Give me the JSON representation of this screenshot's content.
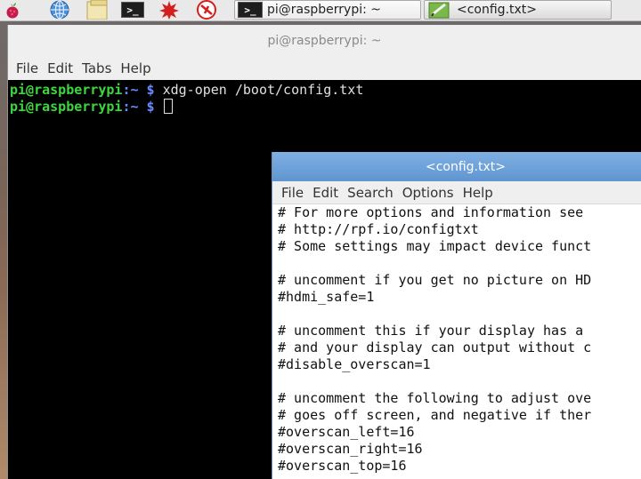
{
  "taskbar": {
    "terminal_task_label": "pi@raspberrypi: ~",
    "editor_task_label": "<config.txt>"
  },
  "terminal": {
    "title": "pi@raspberrypi: ~",
    "menu": [
      "File",
      "Edit",
      "Tabs",
      "Help"
    ],
    "lines": [
      {
        "user": "pi@raspberrypi",
        "path": ":~",
        "sign": " $",
        "command": " xdg-open /boot/config.txt",
        "cursor": false
      },
      {
        "user": "pi@raspberrypi",
        "path": ":~",
        "sign": " $",
        "command": " ",
        "cursor": true
      }
    ]
  },
  "editor": {
    "title": "<config.txt>",
    "menu": [
      "File",
      "Edit",
      "Search",
      "Options",
      "Help"
    ],
    "lines": [
      "# For more options and information see",
      "# http://rpf.io/configtxt",
      "# Some settings may impact device funct",
      "",
      "# uncomment if you get no picture on HD",
      "#hdmi_safe=1",
      "",
      "# uncomment this if your display has a",
      "# and your display can output without c",
      "#disable_overscan=1",
      "",
      "# uncomment the following to adjust ove",
      "# goes off screen, and negative if ther",
      "#overscan_left=16",
      "#overscan_right=16",
      "#overscan_top=16"
    ]
  },
  "colors": {
    "prompt_user": "#3ed63e",
    "prompt_path": "#6a8cff",
    "editor_titlebar": "#6fa3da"
  },
  "icons": [
    "raspberry-menu-icon",
    "web-browser-icon",
    "file-manager-icon",
    "terminal-icon",
    "wolfram-icon",
    "mathematica-icon"
  ]
}
